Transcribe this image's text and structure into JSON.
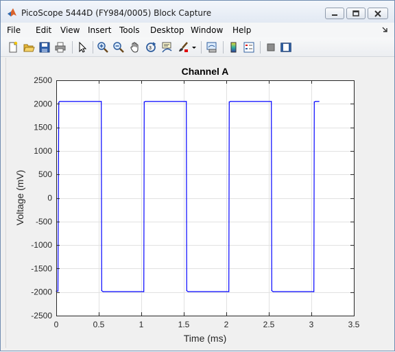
{
  "window": {
    "title": "PicoScope 5444D (FY984/0005) Block Capture",
    "controls": [
      "minimize-icon",
      "maximize-icon",
      "close-icon"
    ]
  },
  "menu": {
    "items": [
      "File",
      "Edit",
      "View",
      "Insert",
      "Tools",
      "Desktop",
      "Window",
      "Help"
    ]
  },
  "toolbar": {
    "buttons": [
      "new-figure-icon",
      "open-file-icon",
      "save-icon",
      "print-icon",
      "select-arrow-icon",
      "zoom-in-icon",
      "zoom-out-icon",
      "pan-hand-icon",
      "rotate-3d-icon",
      "data-cursor-icon",
      "brush-icon",
      "brush-dropdown-icon",
      "link-plot-icon",
      "insert-colorbar-icon",
      "insert-legend-icon",
      "hide-plot-tools-icon",
      "show-plot-tools-icon"
    ]
  },
  "colors": {
    "trace": "#0000ff",
    "axes_bg": "#ffffff",
    "figure_bg": "#f0f0f0",
    "grid": "#e1e1e1"
  },
  "chart_data": {
    "type": "line",
    "title": "Channel A",
    "xlabel": "Time (ms)",
    "ylabel": "Voltage (mV)",
    "xlim": [
      0,
      3.5
    ],
    "ylim": [
      -2500,
      2500
    ],
    "xticks": [
      0,
      0.5,
      1,
      1.5,
      2,
      2.5,
      3,
      3.5
    ],
    "yticks": [
      -2500,
      -2000,
      -1500,
      -1000,
      -500,
      0,
      500,
      1000,
      1500,
      2000,
      2500
    ],
    "xtick_labels": [
      "0",
      "0.5",
      "1",
      "1.5",
      "2",
      "2.5",
      "3",
      "3.5"
    ],
    "ytick_labels": [
      "-2500",
      "-2000",
      "-1500",
      "-1000",
      "-500",
      "0",
      "500",
      "1000",
      "1500",
      "2000",
      "2500"
    ],
    "grid": true,
    "series": [
      {
        "color": "#0000ff",
        "x": [
          0,
          0.02,
          0.03,
          0.04,
          0.53,
          0.535,
          0.55,
          1.03,
          1.035,
          1.05,
          1.53,
          1.535,
          1.55,
          2.03,
          2.035,
          2.05,
          2.53,
          2.535,
          2.55,
          3.03,
          3.035,
          3.05,
          3.09
        ],
        "y": [
          -1980,
          -1980,
          2030,
          2050,
          2050,
          -1970,
          -1990,
          -1990,
          2040,
          2050,
          2050,
          -1970,
          -1990,
          -1990,
          2040,
          2050,
          2050,
          -1970,
          -1990,
          -1990,
          2040,
          2050,
          2050
        ]
      }
    ]
  }
}
